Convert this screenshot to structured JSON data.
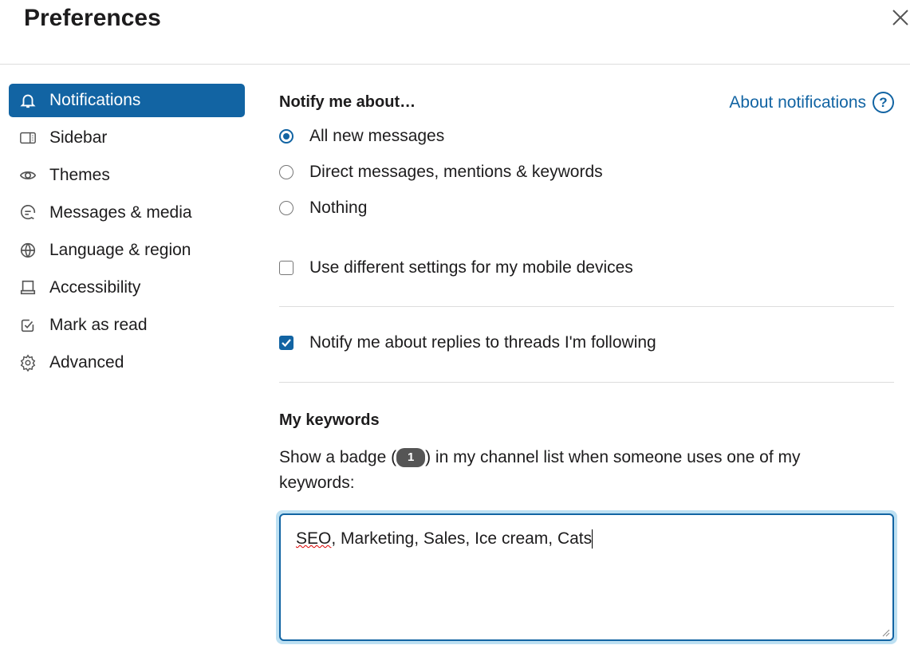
{
  "header": {
    "title": "Preferences",
    "close_icon": "close-icon"
  },
  "sidebar": {
    "items": [
      {
        "label": "Notifications",
        "icon": "bell-icon",
        "active": true
      },
      {
        "label": "Sidebar",
        "icon": "sidebar-icon"
      },
      {
        "label": "Themes",
        "icon": "eye-icon"
      },
      {
        "label": "Messages & media",
        "icon": "message-icon"
      },
      {
        "label": "Language & region",
        "icon": "globe-icon"
      },
      {
        "label": "Accessibility",
        "icon": "laptop-icon"
      },
      {
        "label": "Mark as read",
        "icon": "check-square-icon"
      },
      {
        "label": "Advanced",
        "icon": "gear-icon"
      }
    ]
  },
  "main": {
    "notify_heading": "Notify me about…",
    "about_link": "About notifications",
    "about_icon": "?",
    "radios": [
      {
        "label": "All new messages",
        "selected": true
      },
      {
        "label": "Direct messages, mentions & keywords",
        "selected": false
      },
      {
        "label": "Nothing",
        "selected": false
      }
    ],
    "mobile_checkbox": {
      "label": "Use different settings for my mobile devices",
      "checked": false
    },
    "threads_checkbox": {
      "label": "Notify me about replies to threads I'm following",
      "checked": true
    },
    "keywords": {
      "heading": "My keywords",
      "desc_before": "Show a badge (",
      "badge": "1",
      "desc_after": ") in my channel list when someone uses one of my keywords:",
      "value_misspelled": "SEO",
      "value_rest": ", Marketing, Sales, Ice cream, Cats"
    },
    "accent": "#1264a3"
  }
}
